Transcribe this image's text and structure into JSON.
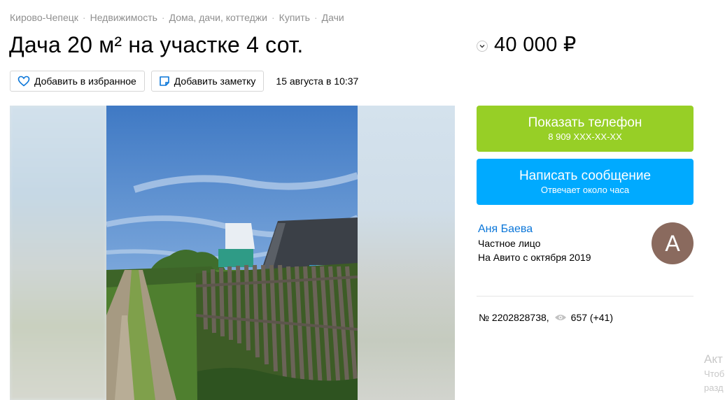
{
  "breadcrumb": [
    "Кирово-Чепецк",
    "Недвижимость",
    "Дома, дачи, коттеджи",
    "Купить",
    "Дачи"
  ],
  "title": "Дача 20 м² на участке 4 сот.",
  "price": "40 000 ₽",
  "actions": {
    "favorite_label": "Добавить в избранное",
    "note_label": "Добавить заметку",
    "date": "15 августа в 10:37"
  },
  "contact": {
    "phone_title": "Показать телефон",
    "phone_masked": "8 909 XXX-XX-XX",
    "message_title": "Написать сообщение",
    "message_sub": "Отвечает около часа"
  },
  "seller": {
    "name": "Аня Баева",
    "type": "Частное лицо",
    "since": "На Авито с октября 2019",
    "avatar_letter": "А"
  },
  "listing": {
    "number": "№ 2202828738,",
    "views": "657 (+41)"
  },
  "cutoff": {
    "heading": "Акт",
    "line1": "Чтоб",
    "line2": "разд"
  },
  "colors": {
    "green": "#97cf26",
    "blue": "#00aaff",
    "link": "#0a76d9",
    "avatar": "#8a6a5e"
  },
  "icons": [
    "heart-icon",
    "note-icon",
    "chevron-down-icon",
    "eye-icon"
  ]
}
